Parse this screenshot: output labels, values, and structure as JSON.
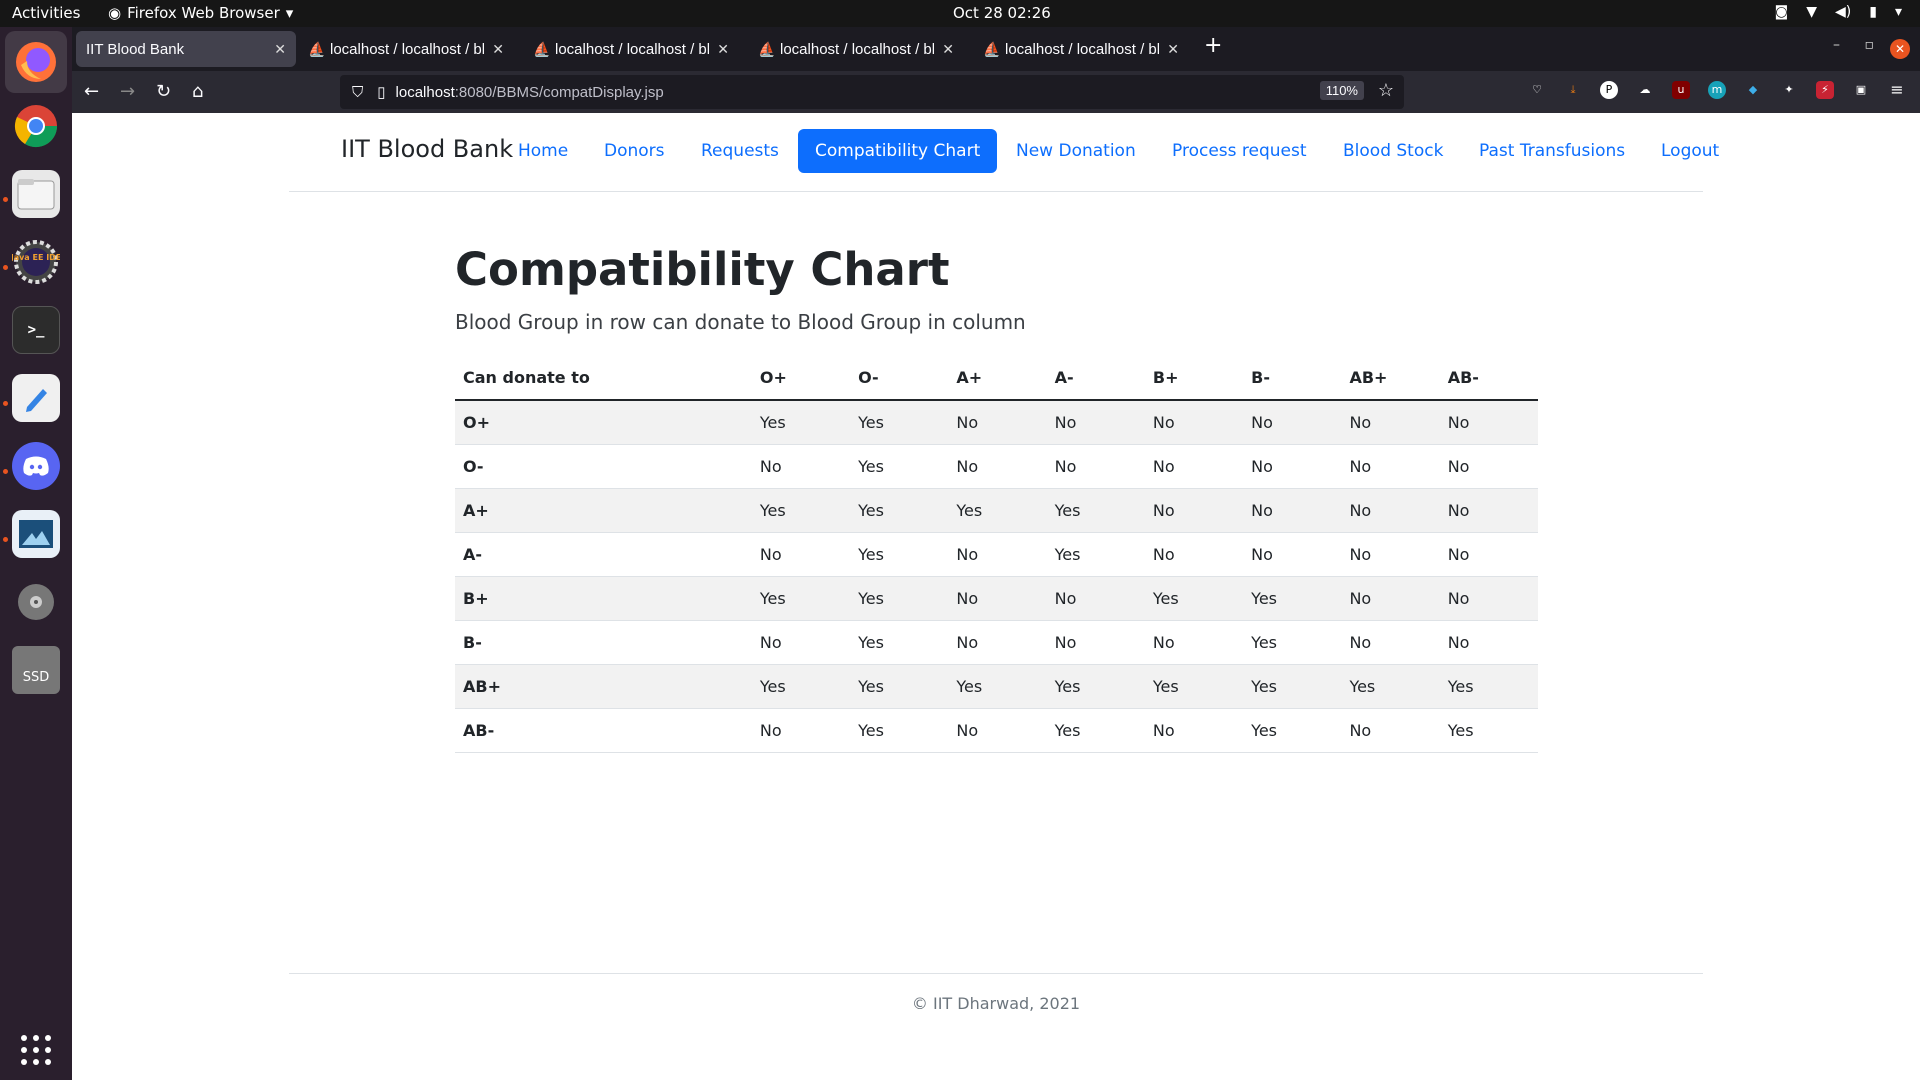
{
  "topbar": {
    "activities": "Activities",
    "app_name": "Firefox Web Browser",
    "clock": "Oct 28  02:26"
  },
  "dock": {
    "items": [
      "firefox-icon",
      "chrome-icon",
      "files-icon",
      "java-ee-ide-icon",
      "terminal-icon",
      "text-editor-icon",
      "discord-icon",
      "image-viewer-icon",
      "disc-icon",
      "ssd-icon",
      "app-grid-icon"
    ],
    "ssd_label": "SSD",
    "ide_label": "Java EE IDE"
  },
  "tabs": [
    {
      "title": "IIT Blood Bank",
      "active": true
    },
    {
      "title": "localhost / localhost / blo",
      "active": false
    },
    {
      "title": "localhost / localhost / blo",
      "active": false
    },
    {
      "title": "localhost / localhost / blo",
      "active": false
    },
    {
      "title": "localhost / localhost / blo",
      "active": false
    }
  ],
  "url": {
    "host": "localhost",
    "path": ":8080/BBMS/compatDisplay.jsp",
    "zoom": "110%"
  },
  "site": {
    "brand": "IIT Blood Bank",
    "nav": [
      "Home",
      "Donors",
      "Requests",
      "Compatibility Chart",
      "New Donation",
      "Process request",
      "Blood Stock",
      "Past Transfusions",
      "Logout"
    ],
    "active_nav": "Compatibility Chart",
    "accent_color": "#0d6efd"
  },
  "content": {
    "title": "Compatibility Chart",
    "subtitle": "Blood Group in row can donate to Blood Group in column",
    "table": {
      "header": [
        "Can donate to",
        "O+",
        "O-",
        "A+",
        "A-",
        "B+",
        "B-",
        "AB+",
        "AB-"
      ],
      "rows": [
        [
          "O+",
          "Yes",
          "Yes",
          "No",
          "No",
          "No",
          "No",
          "No",
          "No"
        ],
        [
          "O-",
          "No",
          "Yes",
          "No",
          "No",
          "No",
          "No",
          "No",
          "No"
        ],
        [
          "A+",
          "Yes",
          "Yes",
          "Yes",
          "Yes",
          "No",
          "No",
          "No",
          "No"
        ],
        [
          "A-",
          "No",
          "Yes",
          "No",
          "Yes",
          "No",
          "No",
          "No",
          "No"
        ],
        [
          "B+",
          "Yes",
          "Yes",
          "No",
          "No",
          "Yes",
          "Yes",
          "No",
          "No"
        ],
        [
          "B-",
          "No",
          "Yes",
          "No",
          "No",
          "No",
          "Yes",
          "No",
          "No"
        ],
        [
          "AB+",
          "Yes",
          "Yes",
          "Yes",
          "Yes",
          "Yes",
          "Yes",
          "Yes",
          "Yes"
        ],
        [
          "AB-",
          "No",
          "Yes",
          "No",
          "Yes",
          "No",
          "Yes",
          "No",
          "Yes"
        ]
      ]
    }
  },
  "footer": {
    "text": "© IIT Dharwad, 2021"
  }
}
